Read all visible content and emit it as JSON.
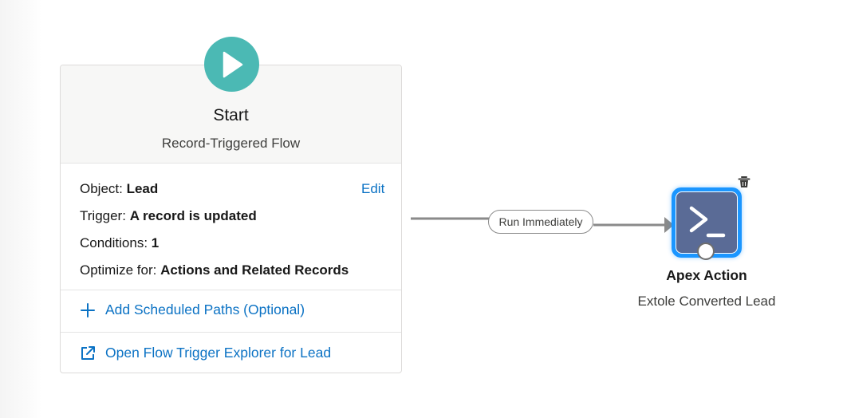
{
  "start": {
    "title": "Start",
    "subtitle": "Record-Triggered Flow",
    "object_label": "Object:",
    "object_value": "Lead",
    "edit_label": "Edit",
    "trigger_label": "Trigger:",
    "trigger_value": "A record is updated",
    "conditions_label": "Conditions:",
    "conditions_value": "1",
    "optimize_label": "Optimize for:",
    "optimize_value": "Actions and Related Records",
    "add_paths_label": "Add Scheduled Paths (Optional)",
    "explorer_label": "Open Flow Trigger Explorer for Lead"
  },
  "connector": {
    "label": "Run Immediately"
  },
  "apex": {
    "title": "Apex Action",
    "subtitle": "Extole Converted Lead"
  },
  "icons": {
    "start": "play-icon",
    "add": "plus-icon",
    "explorer": "external-link-icon",
    "apex": "terminal-icon",
    "delete": "trash-icon"
  },
  "colors": {
    "start_circle": "#4bb9b4",
    "link": "#0b72c4",
    "apex_fill": "#5a6b96",
    "selection": "#1b96ff"
  }
}
